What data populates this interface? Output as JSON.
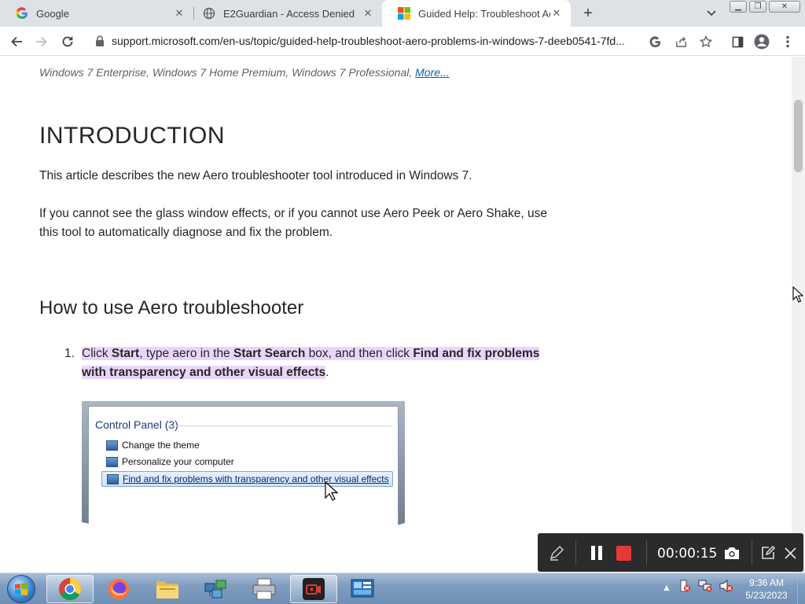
{
  "tabs": [
    {
      "title": "Google",
      "favicon": "google-icon",
      "active": false
    },
    {
      "title": "E2Guardian - Access Denied",
      "favicon": "globe-icon",
      "active": false
    },
    {
      "title": "Guided Help: Troubleshoot Aero",
      "favicon": "microsoft-icon",
      "active": true
    }
  ],
  "address": {
    "url": "support.microsoft.com/en-us/topic/guided-help-troubleshoot-aero-problems-in-windows-7-deeb0541-7fd..."
  },
  "article": {
    "applies_to": "Windows 7 Enterprise, Windows 7 Home Premium, Windows 7 Professional, ",
    "more_link": "More...",
    "intro_heading": "INTRODUCTION",
    "para1": "This article describes the new Aero troubleshooter tool introduced in Windows 7.",
    "para2": "If you cannot see the glass window effects, or if you cannot use Aero Peek or Aero Shake, use this tool to automatically diagnose and fix the problem.",
    "how_heading": "How to use Aero troubleshooter",
    "step1": {
      "num": "1.",
      "p1": "Click ",
      "b1": "Start",
      "p2": ", type aero in the ",
      "b2": "Start Search",
      "p3": " box, and then click ",
      "b3": "Find and fix problems with transparency and other visual effects",
      "p4": "."
    },
    "screenshot": {
      "title": "Control Panel (3)",
      "items": [
        "Change the theme",
        "Personalize your computer",
        "Find and fix problems with transparency and other visual effects"
      ]
    }
  },
  "recorder": {
    "time": "00:00:15"
  },
  "taskbar": {
    "time": "9:36 AM",
    "date": "5/23/2023"
  },
  "colors": {
    "highlight": "#ead5fa",
    "link": "#0067b8",
    "rec_stop": "#e53935"
  }
}
